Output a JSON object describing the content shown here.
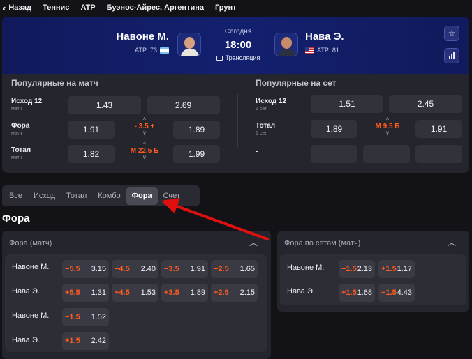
{
  "breadcrumbs": {
    "back_label": "Назад",
    "items": [
      "Теннис",
      "ATP",
      "Буэнос-Айрес, Аргентина",
      "Грунт"
    ]
  },
  "match": {
    "player1": {
      "name": "Навоне М.",
      "rank": "ATP: 73",
      "flag": "argentina-flag"
    },
    "player2": {
      "name": "Нава Э.",
      "rank": "ATP: 81",
      "flag": "usa-flag"
    },
    "day": "Сегодня",
    "time": "18:00",
    "stream_label": "Трансляция"
  },
  "popular_match": {
    "title": "Популярные на матч",
    "rows": [
      {
        "label": "Исход 12",
        "sub": "матч",
        "odd1": "1.43",
        "odd2": "2.69"
      },
      {
        "label": "Фора",
        "sub": "матч",
        "odd1": "1.91",
        "line": "- 3.5 +",
        "odd2": "1.89"
      },
      {
        "label": "Тотал",
        "sub": "матч",
        "odd1": "1.82",
        "line": "М 22.5 Б",
        "odd2": "1.99"
      }
    ]
  },
  "popular_set": {
    "title": "Популярные на сет",
    "rows": [
      {
        "label": "Исход 12",
        "sub": "1 сет",
        "odd1": "1.51",
        "odd2": "2.45"
      },
      {
        "label": "Тотал",
        "sub": "1 сет",
        "odd1": "1.89",
        "line": "М 9.5 Б",
        "odd2": "1.91"
      },
      {
        "label": "-"
      }
    ]
  },
  "tabs": [
    "Все",
    "Исход",
    "Тотал",
    "Комбо",
    "Фора",
    "Счет"
  ],
  "active_tab": "Фора",
  "section_title": "Фора",
  "handicap_match": {
    "title": "Фора (матч)",
    "rows": [
      {
        "player": "Навоне М.",
        "cells": [
          {
            "line": "−5.5",
            "odd": "3.15"
          },
          {
            "line": "−4.5",
            "odd": "2.40"
          },
          {
            "line": "−3.5",
            "odd": "1.91"
          },
          {
            "line": "−2.5",
            "odd": "1.65"
          }
        ]
      },
      {
        "player": "Нава Э.",
        "cells": [
          {
            "line": "+5.5",
            "odd": "1.31"
          },
          {
            "line": "+4.5",
            "odd": "1.53"
          },
          {
            "line": "+3.5",
            "odd": "1.89"
          },
          {
            "line": "+2.5",
            "odd": "2.15"
          }
        ]
      },
      {
        "player": "Навоне М.",
        "cells": [
          {
            "line": "−1.5",
            "odd": "1.52"
          }
        ]
      },
      {
        "player": "Нава Э.",
        "cells": [
          {
            "line": "+1.5",
            "odd": "2.42"
          }
        ]
      }
    ]
  },
  "handicap_sets": {
    "title": "Фора по сетам (матч)",
    "rows": [
      {
        "player": "Навоне М.",
        "cells": [
          {
            "line": "−1.5",
            "odd": "2.13"
          },
          {
            "line": "+1.5",
            "odd": "1.17"
          }
        ]
      },
      {
        "player": "Нава Э.",
        "cells": [
          {
            "line": "+1.5",
            "odd": "1.68"
          },
          {
            "line": "−1.5",
            "odd": "4.43"
          }
        ]
      }
    ]
  },
  "colors": {
    "accent_orange": "#ff5a1f",
    "hero_blue": "#13206e",
    "annotation_red": "#e01010"
  }
}
